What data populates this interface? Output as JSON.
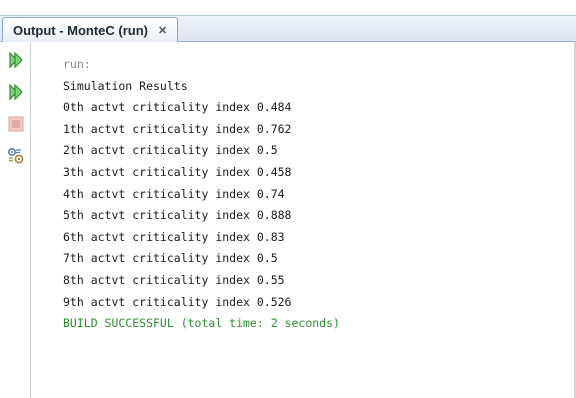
{
  "window": {
    "tab_title": "Output - MonteC (run)",
    "tab_close_glyph": "✕"
  },
  "gutter": {
    "buttons": [
      {
        "name": "rerun-icon",
        "color": "#3aa63a"
      },
      {
        "name": "rerun-with-params-icon",
        "color": "#3aa63a"
      },
      {
        "name": "stop-icon",
        "color": "#d98a8a"
      },
      {
        "name": "settings-icon",
        "color": "#5a7fa8"
      }
    ]
  },
  "console": {
    "lines": [
      {
        "text": "run:",
        "kind": "meta"
      },
      {
        "text": "Simulation Results",
        "kind": "normal"
      },
      {
        "text": "0th actvt criticality index 0.484",
        "kind": "normal"
      },
      {
        "text": "1th actvt criticality index 0.762",
        "kind": "normal"
      },
      {
        "text": "2th actvt criticality index 0.5",
        "kind": "normal"
      },
      {
        "text": "3th actvt criticality index 0.458",
        "kind": "normal"
      },
      {
        "text": "4th actvt criticality index 0.74",
        "kind": "normal"
      },
      {
        "text": "5th actvt criticality index 0.888",
        "kind": "normal"
      },
      {
        "text": "6th actvt criticality index 0.83",
        "kind": "normal"
      },
      {
        "text": "7th actvt criticality index 0.5",
        "kind": "normal"
      },
      {
        "text": "8th actvt criticality index 0.55",
        "kind": "normal"
      },
      {
        "text": "9th actvt criticality index 0.526",
        "kind": "normal"
      },
      {
        "text": "BUILD SUCCESSFUL (total time: 2 seconds)",
        "kind": "success"
      }
    ]
  }
}
